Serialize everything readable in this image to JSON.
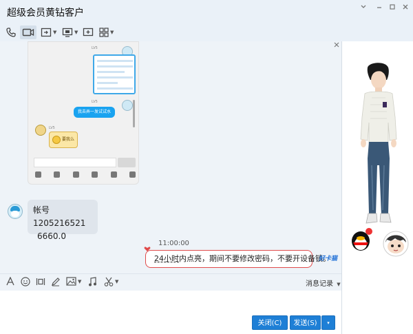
{
  "window": {
    "title": "超级会员黄钻客户",
    "controls": [
      "pin",
      "minimize",
      "maximize",
      "close"
    ]
  },
  "toolbar": {
    "items": [
      {
        "name": "voice-call",
        "icon": "phone-icon"
      },
      {
        "name": "video-call",
        "icon": "video-camera-icon",
        "active": true
      },
      {
        "name": "screen-share",
        "icon": "share-screen-icon"
      },
      {
        "name": "remote-desktop",
        "icon": "monitor-icon"
      },
      {
        "name": "send-file",
        "icon": "plus-square-icon"
      },
      {
        "name": "apps",
        "icon": "grid-apps-icon"
      }
    ]
  },
  "messages": {
    "account_bubble": {
      "line1": "帐号  1205216521",
      "line2": "6660.0"
    },
    "timestamp": "11:00:00",
    "reply_bubble": {
      "underlined": "24小时",
      "rest": "内点亮，期间不要修改密码，不要开设备锁。"
    },
    "badge_text": "好卡猫",
    "embedded_screenshot": {
      "bubble_text": "我去弄一发试试水",
      "gift_text": "要我么",
      "level_tag": "LV5"
    }
  },
  "input_toolbar": {
    "tools": [
      "font-icon",
      "emoji-icon",
      "video-clip-icon",
      "pen-icon",
      "image-icon",
      "music-icon",
      "scissors-icon"
    ],
    "history_label": "消息记录"
  },
  "buttons": {
    "close_label": "关闭(C)",
    "send_label": "发送(S)",
    "send_menu": "▾"
  },
  "colors": {
    "accent": "#1e7fd6",
    "highlight_border": "#e04a4a",
    "bubble_left": "#dfe5ec",
    "background": "#eef3f8"
  }
}
